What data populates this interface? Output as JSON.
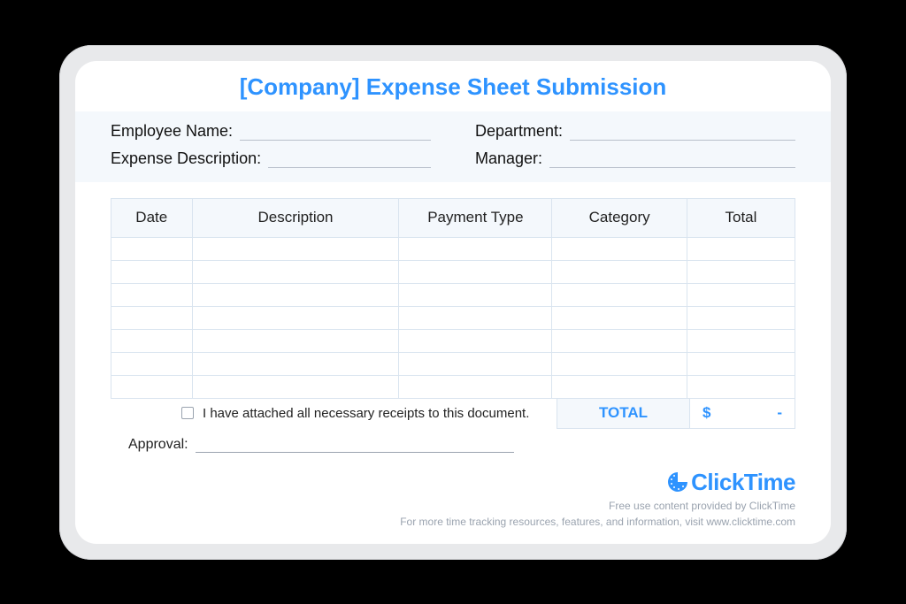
{
  "title": "[Company] Expense Sheet Submission",
  "fields": {
    "employee_name": "Employee Name:",
    "department": "Department:",
    "expense_desc": "Expense Description:",
    "manager": "Manager:"
  },
  "table": {
    "headers": [
      "Date",
      "Description",
      "Payment Type",
      "Category",
      "Total"
    ],
    "row_count": 7
  },
  "totals": {
    "label": "TOTAL",
    "currency": "$",
    "value": "-"
  },
  "receipt_note": "I have attached all necessary receipts to this document.",
  "approval_label": "Approval:",
  "brand": {
    "name": "ClickTime"
  },
  "footer": {
    "line1": "Free use content provided by ClickTime",
    "line2": "For more time tracking resources, features, and information, visit www.clicktime.com"
  }
}
